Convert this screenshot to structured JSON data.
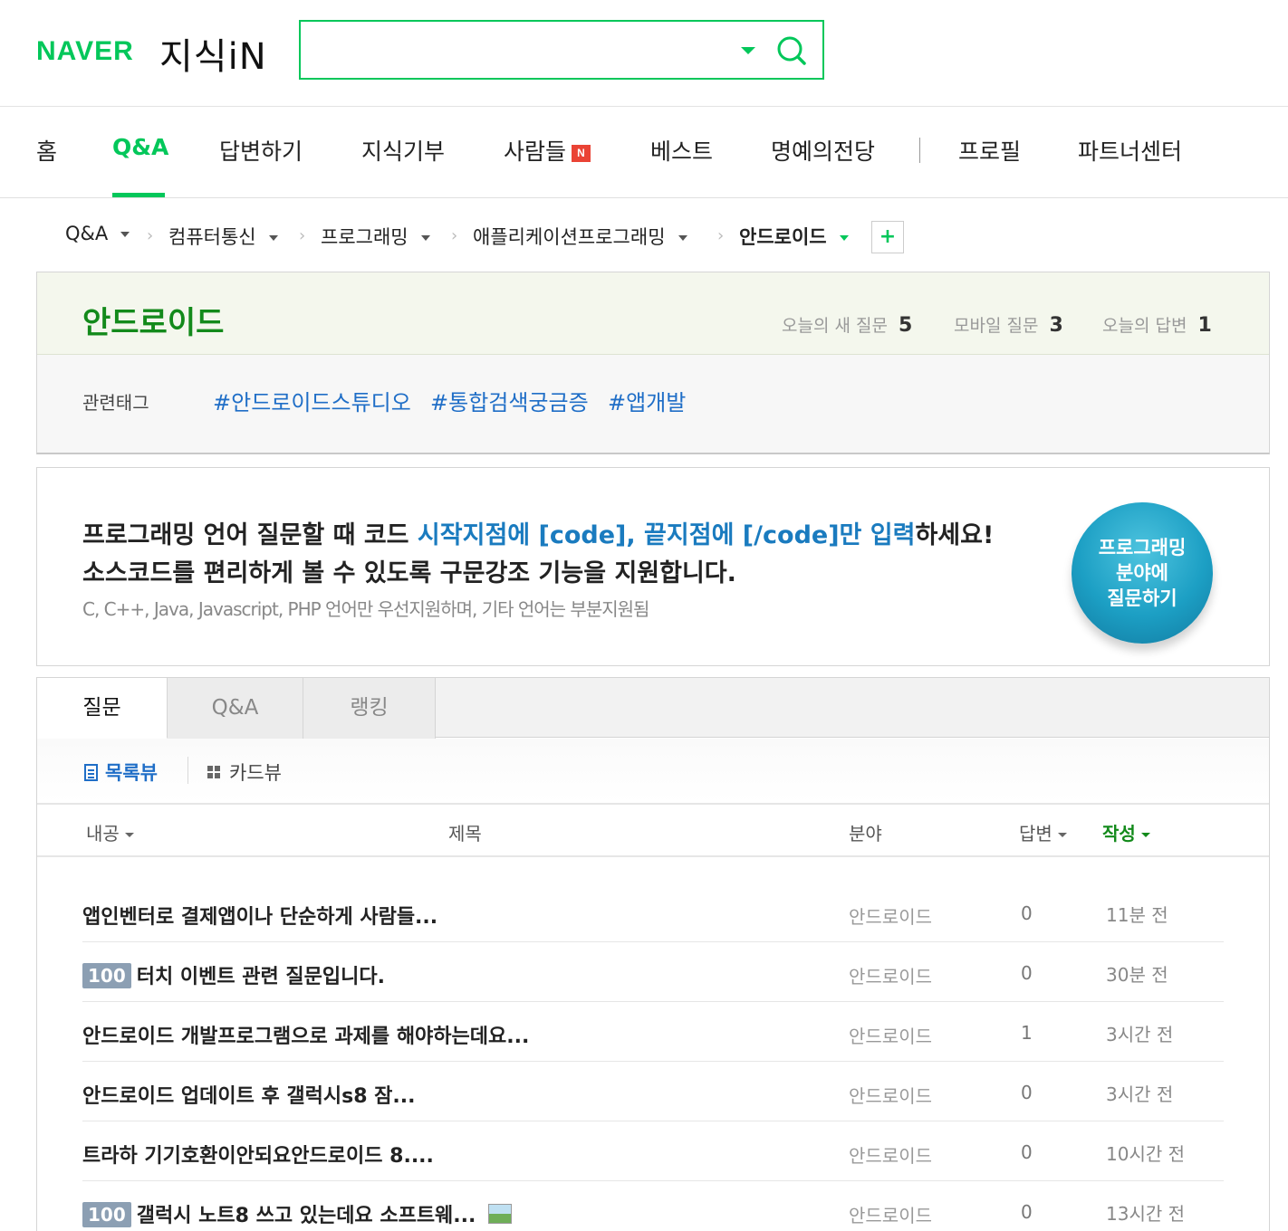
{
  "header": {
    "logo_naver": "NAVER",
    "logo_service": "지식iN",
    "search_value": "",
    "search_placeholder": ""
  },
  "gnb": {
    "items": [
      "홈",
      "Q&A",
      "답변하기",
      "지식기부",
      "사람들",
      "베스트",
      "명예의전당",
      "프로필",
      "파트너센터"
    ],
    "active": "Q&A",
    "new_badge": "N"
  },
  "breadcrumb": [
    "Q&A",
    "컴퓨터통신",
    "프로그래밍",
    "애플리케이션프로그래밍",
    "안드로이드"
  ],
  "breadcrumb_add": "+",
  "category": {
    "title": "안드로이드",
    "stats": [
      {
        "label": "오늘의 새 질문",
        "value": "5"
      },
      {
        "label": "모바일 질문",
        "value": "3"
      },
      {
        "label": "오늘의 답변",
        "value": "1"
      }
    ],
    "tag_label": "관련태그",
    "tags": [
      "#안드로이드스튜디오",
      "#통합검색궁금증",
      "#앱개발"
    ]
  },
  "banner": {
    "line1_a": "프로그래밍 언어 질문할 때 코드 ",
    "line1_hl": "시작지점에 [code], 끝지점에 [/code]만 입력",
    "line1_b": "하세요!",
    "line2": "소스코드를 편리하게 볼 수 있도록 구문강조 기능을 지원합니다.",
    "line3": "C, C++, Java, Javascript, PHP 언어만 우선지원하며, 기타 언어는 부분지원됨",
    "button": "프로그래밍\n분야에\n질문하기"
  },
  "tabs": [
    "질문",
    "Q&A",
    "랭킹"
  ],
  "views": {
    "list": "목록뷰",
    "card": "카드뷰"
  },
  "table": {
    "headers": {
      "bounty": "내공",
      "title": "제목",
      "field": "분야",
      "answers": "답변",
      "date": "작성"
    },
    "rows": [
      {
        "bounty": "",
        "title": "앱인벤터로 결제앱이나 단순하게 사람들...",
        "field": "안드로이드",
        "answers": "0",
        "time": "11분 전",
        "has_image": false
      },
      {
        "bounty": "100",
        "title": "터치 이벤트 관련 질문입니다.",
        "field": "안드로이드",
        "answers": "0",
        "time": "30분 전",
        "has_image": false
      },
      {
        "bounty": "",
        "title": "안드로이드 개발프로그램으로 과제를 해야하는데요...",
        "field": "안드로이드",
        "answers": "1",
        "time": "3시간 전",
        "has_image": false
      },
      {
        "bounty": "",
        "title": "안드로이드 업데이트 후 갤럭시s8 잠...",
        "field": "안드로이드",
        "answers": "0",
        "time": "3시간 전",
        "has_image": false
      },
      {
        "bounty": "",
        "title": "트라하 기기호환이안되요안드로이드 8....",
        "field": "안드로이드",
        "answers": "0",
        "time": "10시간 전",
        "has_image": false
      },
      {
        "bounty": "100",
        "title": "갤럭시 노트8 쓰고 있는데요 소프트웨...",
        "field": "안드로이드",
        "answers": "0",
        "time": "13시간 전",
        "has_image": true
      }
    ]
  },
  "colors": {
    "brand": "#03c75a",
    "link": "#1f6ec7",
    "category_title": "#138a1b",
    "bounty_badge": "#8c9fb3",
    "banner_circle": "#1c9fc4"
  }
}
